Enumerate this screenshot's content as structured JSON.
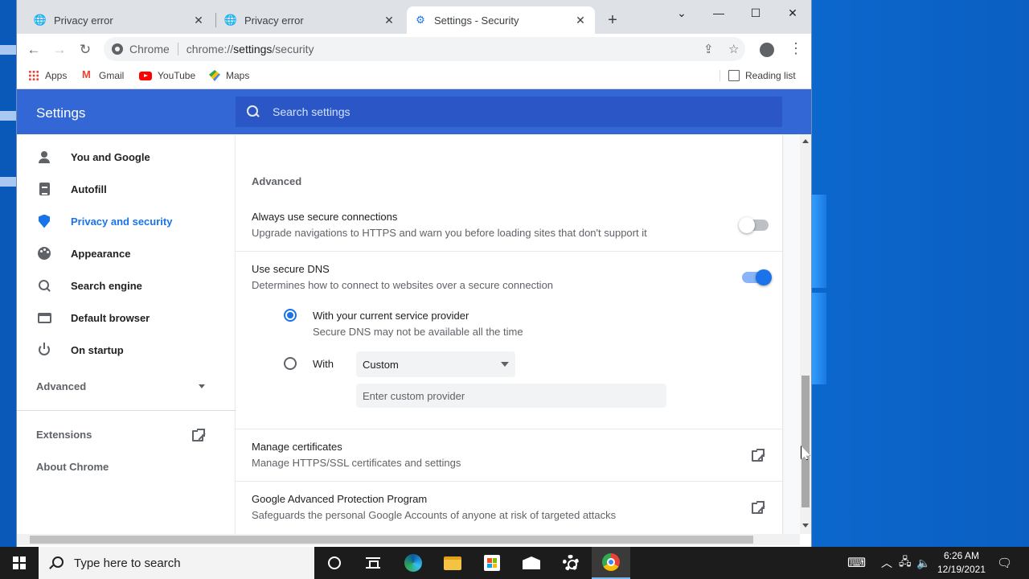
{
  "tabs": [
    {
      "title": "Privacy error",
      "icon": "globe-icon"
    },
    {
      "title": "Privacy error",
      "icon": "globe-icon"
    },
    {
      "title": "Settings - Security",
      "icon": "gear-icon",
      "active": true
    }
  ],
  "omnibox": {
    "scheme_label": "Chrome",
    "url_prefix": "chrome://",
    "url_host": "settings",
    "url_path": "/security"
  },
  "bookmarks": [
    {
      "label": "Apps",
      "icon": "apps-grid-icon"
    },
    {
      "label": "Gmail",
      "icon": "gmail-icon"
    },
    {
      "label": "YouTube",
      "icon": "youtube-icon"
    },
    {
      "label": "Maps",
      "icon": "maps-icon"
    }
  ],
  "reading_list": "Reading list",
  "settings": {
    "title": "Settings",
    "search_placeholder": "Search settings"
  },
  "sidebar": {
    "items": [
      {
        "label": "You and Google",
        "icon": "person-icon"
      },
      {
        "label": "Autofill",
        "icon": "clipboard-icon"
      },
      {
        "label": "Privacy and security",
        "icon": "shield-icon",
        "active": true
      },
      {
        "label": "Appearance",
        "icon": "palette-icon"
      },
      {
        "label": "Search engine",
        "icon": "search-icon"
      },
      {
        "label": "Default browser",
        "icon": "browser-icon"
      },
      {
        "label": "On startup",
        "icon": "power-icon"
      }
    ],
    "advanced": "Advanced",
    "extensions": "Extensions",
    "about": "About Chrome"
  },
  "main": {
    "section_title": "Advanced",
    "https": {
      "title": "Always use secure connections",
      "subtitle": "Upgrade navigations to HTTPS and warn you before loading sites that don't support it",
      "enabled": false
    },
    "dns": {
      "title": "Use secure DNS",
      "subtitle": "Determines how to connect to websites over a secure connection",
      "enabled": true,
      "option_current": "With your current service provider",
      "option_current_sub": "Secure DNS may not be available all the time",
      "option_with": "With",
      "provider_selected": "Custom",
      "custom_placeholder": "Enter custom provider"
    },
    "certificates": {
      "title": "Manage certificates",
      "subtitle": "Manage HTTPS/SSL certificates and settings"
    },
    "advanced_protection": {
      "title": "Google Advanced Protection Program",
      "subtitle": "Safeguards the personal Google Accounts of anyone at risk of targeted attacks"
    }
  },
  "taskbar": {
    "search_placeholder": "Type here to search",
    "time": "6:26 AM",
    "date": "12/19/2021"
  }
}
